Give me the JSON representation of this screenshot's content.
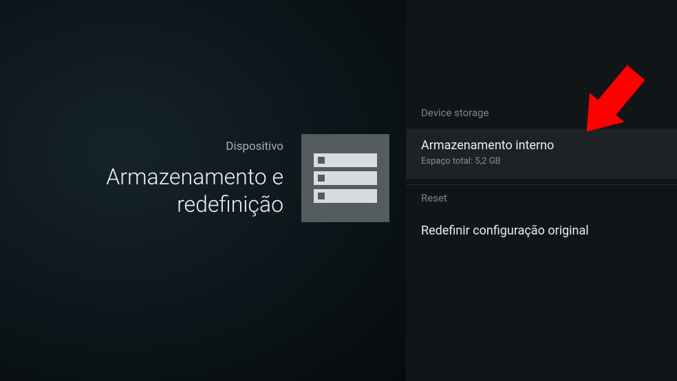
{
  "left": {
    "category_label": "Dispositivo",
    "title_line1": "Armazenamento e",
    "title_line2": "redefinição"
  },
  "right": {
    "section_storage_header": "Device storage",
    "internal_storage": {
      "title": "Armazenamento interno",
      "subtitle": "Espaço total: 5,2 GB"
    },
    "section_reset_header": "Reset",
    "factory_reset_title": "Redefinir configuração original"
  }
}
